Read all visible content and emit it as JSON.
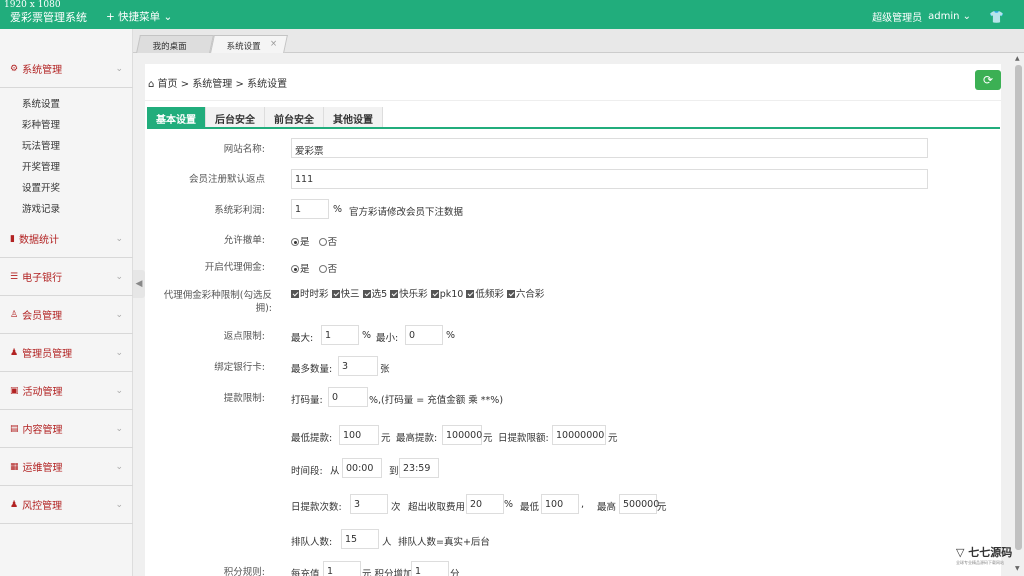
{
  "resolution": "1920 x 1080",
  "header": {
    "brand": "爱彩票管理系统",
    "quick_menu": "快捷菜单",
    "role": "超级管理员",
    "user": "admin"
  },
  "sidebar": {
    "groups": [
      {
        "label": "系统管理",
        "icon": "gear-icon",
        "children": [
          "系统设置",
          "彩种管理",
          "玩法管理",
          "开奖管理",
          "设置开奖",
          "游戏记录"
        ]
      },
      {
        "label": "数据统计",
        "icon": "chart-icon"
      },
      {
        "label": "电子银行",
        "icon": "list-icon"
      },
      {
        "label": "会员管理",
        "icon": "user-outline-icon"
      },
      {
        "label": "管理员管理",
        "icon": "user-icon"
      },
      {
        "label": "活动管理",
        "icon": "gift-icon"
      },
      {
        "label": "内容管理",
        "icon": "book-icon"
      },
      {
        "label": "运维管理",
        "icon": "server-icon"
      },
      {
        "label": "风控管理",
        "icon": "shield-user-icon"
      }
    ]
  },
  "page_tabs": [
    {
      "label": "我的桌面"
    },
    {
      "label": "系统设置",
      "close": "×"
    }
  ],
  "breadcrumb": {
    "home": "首页",
    "sep": ">",
    "level1": "系统管理",
    "level2": "系统设置"
  },
  "settings_tabs": [
    "基本设置",
    "后台安全",
    "前台安全",
    "其他设置"
  ],
  "form": {
    "site_name": {
      "label": "网站名称:",
      "value": "爱彩票"
    },
    "rebate": {
      "label": "会员注册默认返点",
      "value": "111"
    },
    "profit": {
      "label": "系统彩利润:",
      "value": "1",
      "unit": "%",
      "note": "官方彩请修改会员下注数据"
    },
    "cancel": {
      "label": "允许撤单:",
      "yes": "是",
      "no": "否"
    },
    "agent": {
      "label": "开启代理佣金:",
      "yes": "是",
      "no": "否"
    },
    "agent_limit": {
      "label": "代理佣金彩种限制(勾选反拥):",
      "options": [
        "时时彩",
        "快三",
        "选5",
        "快乐彩",
        "pk10",
        "低频彩",
        "六合彩"
      ]
    },
    "rebate_limit": {
      "label": "返点限制:",
      "max_label": "最大:",
      "max": "1",
      "pct": "%",
      "min_label": "最小:",
      "min": "0"
    },
    "bank": {
      "label": "绑定银行卡:",
      "max_label": "最多数量:",
      "value": "3",
      "unit": "张"
    },
    "withdraw": {
      "label": "提款限制:",
      "code_label": "打码量:",
      "code": "0",
      "code_note": "%,(打码量 = 充值金额 乘 **%)",
      "min_label": "最低提款:",
      "min": "100",
      "yuan": "元",
      "max_label": "最高提款:",
      "max": "100000",
      "daily_label": "日提款限额:",
      "daily": "10000000",
      "time_label": "时间段:",
      "from_label": "从",
      "from": "00:00",
      "to_label": "到",
      "to": "23:59",
      "count_label": "日提款次数:",
      "count": "3",
      "count_unit": "次",
      "fee_label": "超出收取费用",
      "fee": "20",
      "fee_pct": "%",
      "fee_min_label": "最低",
      "fee_min": "100",
      "comma": ",",
      "fee_max_label": "最高",
      "fee_max": "500000",
      "queue_label": "排队人数:",
      "queue": "15",
      "queue_unit": "人",
      "queue_note": "排队人数=真实+后台"
    },
    "points": {
      "label": "积分规则:",
      "per_label": "每充值",
      "per": "1",
      "add_label": "元 积分增加",
      "add": "1",
      "unit": "分"
    }
  },
  "watermark": {
    "text": "七七源码",
    "sub": "全球专业精品源码下载网站"
  },
  "colors": {
    "primary": "#21ad7c",
    "danger": "#b22222",
    "refresh": "#3cb054"
  }
}
